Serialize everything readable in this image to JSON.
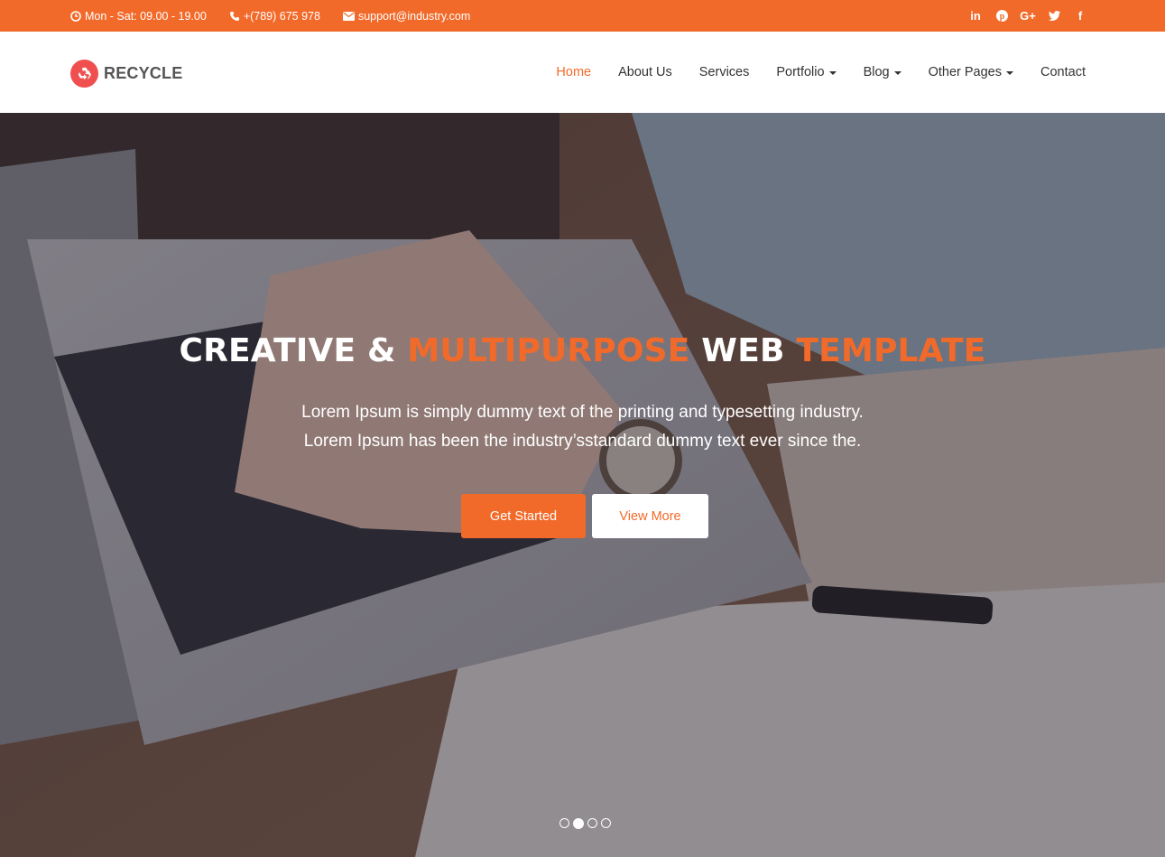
{
  "topbar": {
    "hours": "Mon - Sat: 09.00 - 19.00",
    "phone": "+(789) 675 978",
    "email": "support@industry.com",
    "social": [
      "in",
      "p",
      "G+",
      "t",
      "f"
    ]
  },
  "header": {
    "logo_text": "RECYCLE",
    "nav": [
      {
        "label": "Home",
        "active": true,
        "dropdown": false
      },
      {
        "label": "About Us",
        "active": false,
        "dropdown": false
      },
      {
        "label": "Services",
        "active": false,
        "dropdown": false
      },
      {
        "label": "Portfolio",
        "active": false,
        "dropdown": true
      },
      {
        "label": "Blog",
        "active": false,
        "dropdown": true
      },
      {
        "label": "Other Pages",
        "active": false,
        "dropdown": true
      },
      {
        "label": "Contact",
        "active": false,
        "dropdown": false
      }
    ]
  },
  "hero": {
    "title_part1": "CREATIVE & ",
    "title_part2": "MULTIPURPOSE",
    "title_part3": " WEB ",
    "title_part4": "TEMPLATE",
    "subtitle_line1": "Lorem Ipsum is simply dummy text of the printing and typesetting industry.",
    "subtitle_line2": "Lorem Ipsum has been the industry’sstandard dummy text ever since the.",
    "primary_button": "Get Started",
    "secondary_button": "View More",
    "slider_dots": 4,
    "active_dot": 2
  },
  "colors": {
    "accent": "#f26a2a",
    "logo": "#ef4f4f",
    "nav_text": "#333333"
  }
}
